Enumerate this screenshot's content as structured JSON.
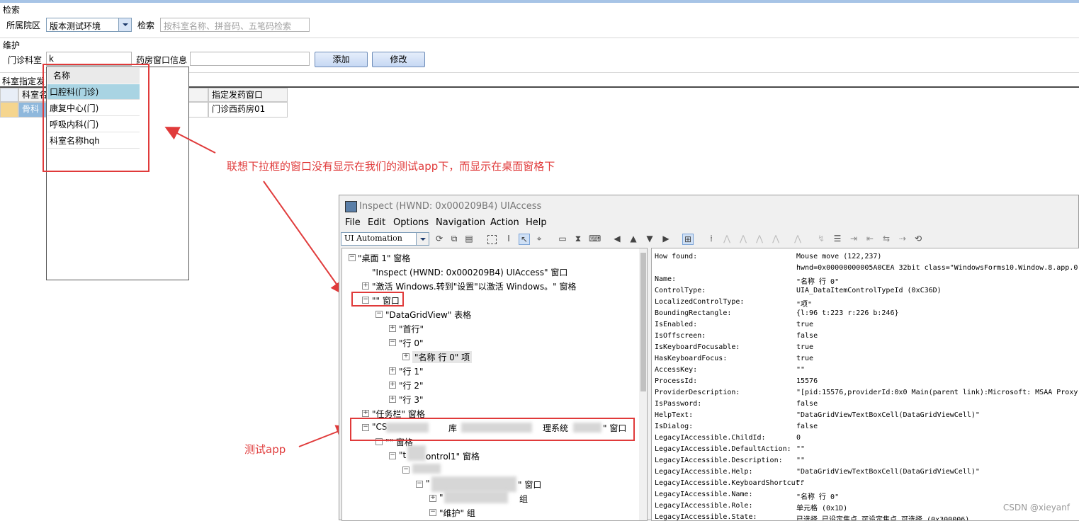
{
  "search": {
    "group_label": "检索",
    "campus_label": "所属院区",
    "campus_value": "版本测试环境",
    "search_label": "检索",
    "search_placeholder": "按科室名称、拼音码、五笔码检索"
  },
  "maintain": {
    "group_label": "维护",
    "clinic_dept_label": "门诊科室",
    "clinic_dept_value": "k",
    "pharmacy_window_label": "药房窗口信息",
    "add_button": "添加",
    "modify_button": "修改"
  },
  "grid": {
    "section_label": "科室指定发",
    "col_dept": "科室名",
    "col_window": "指定发药窗口",
    "row0_dept": "骨科",
    "row0_window": "门诊西药房01"
  },
  "dropdown": {
    "header": "名称",
    "items": [
      "口腔科(门诊)",
      "康复中心(门)",
      "呼吸内科(门)",
      "科室名称hqh"
    ]
  },
  "annotations": {
    "dropdown_note": "联想下拉框的窗口没有显示在我们的测试app下，而显示在桌面窗格下",
    "app_note": "测试app"
  },
  "inspect": {
    "title": "Inspect  (HWND: 0x000209B4) UIAccess",
    "menu": [
      "File",
      "Edit",
      "Options",
      "Navigation",
      "Action",
      "Help"
    ],
    "mode": "UI Automation",
    "tree": [
      "\"桌面 1\" 窗格",
      "\"Inspect  (HWND: 0x000209B4) UIAccess\" 窗口",
      "\"激活 Windows.转到\"设置\"以激活 Windows。\" 窗格",
      "\"\" 窗口",
      "\"DataGridView\" 表格",
      "\"首行\"",
      "\"行 0\"",
      "\"名称 行 0\" 项",
      "\"行 1\"",
      "\"行 2\"",
      "\"行 3\"",
      "\"任务栏\" 窗格",
      "\"CS",
      "库",
      "理系统",
      "\" 窗口",
      "\"\" 窗格",
      "\"t",
      "ontrol1\" 窗格",
      "\"",
      "\" 窗口",
      "\"",
      "组",
      "\"维护\" 组"
    ],
    "props": [
      [
        "How found:",
        "Mouse move (122,237)"
      ],
      [
        "",
        "hwnd=0x00000000005A0CEA 32bit class=\"WindowsForms10.Window.8.app.0."
      ],
      [
        "Name:",
        "\"名称 行 0\""
      ],
      [
        "ControlType:",
        "UIA_DataItemControlTypeId (0xC36D)"
      ],
      [
        "LocalizedControlType:",
        "\"项\""
      ],
      [
        "BoundingRectangle:",
        "{l:96 t:223 r:226 b:246}"
      ],
      [
        "IsEnabled:",
        "true"
      ],
      [
        "IsOffscreen:",
        "false"
      ],
      [
        "IsKeyboardFocusable:",
        "true"
      ],
      [
        "HasKeyboardFocus:",
        "true"
      ],
      [
        "AccessKey:",
        "\"\""
      ],
      [
        "ProcessId:",
        "15576"
      ],
      [
        "ProviderDescription:",
        "\"[pid:15576,providerId:0x0 Main(parent link):Microsoft: MSAA Proxy"
      ],
      [
        "IsPassword:",
        "false"
      ],
      [
        "HelpText:",
        "\"DataGridViewTextBoxCell(DataGridViewCell)\""
      ],
      [
        "IsDialog:",
        "false"
      ],
      [
        "LegacyIAccessible.ChildId:",
        "0"
      ],
      [
        "LegacyIAccessible.DefaultAction:",
        "\"\""
      ],
      [
        "LegacyIAccessible.Description:",
        "\"\""
      ],
      [
        "LegacyIAccessible.Help:",
        "\"DataGridViewTextBoxCell(DataGridViewCell)\""
      ],
      [
        "LegacyIAccessible.KeyboardShortcut:",
        "\"\""
      ],
      [
        "LegacyIAccessible.Name:",
        "\"名称 行 0\""
      ],
      [
        "LegacyIAccessible.Role:",
        "单元格 (0x1D)"
      ],
      [
        "LegacyIAccessible.State:",
        "已选择,已设定焦点,可设定焦点,可选择 (0x300006)"
      ]
    ]
  },
  "watermark": "CSDN @xieyanf"
}
